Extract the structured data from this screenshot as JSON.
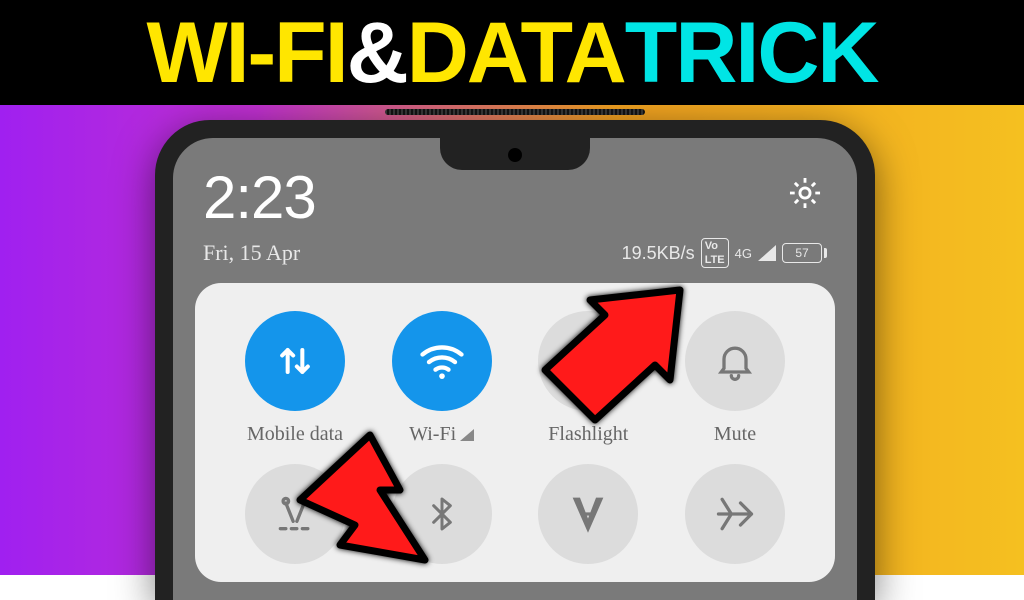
{
  "title": {
    "part1": "WI-FI",
    "part2": " & ",
    "part3": "DATA ",
    "part4": "TRICK"
  },
  "status": {
    "time": "2:23",
    "date": "Fri, 15 Apr",
    "speed": "19.5KB/s",
    "volte": "Vo LTE",
    "signal": "4G",
    "battery": "57"
  },
  "tiles": {
    "row1": [
      {
        "label": "Mobile data",
        "active": true,
        "icon": "data"
      },
      {
        "label": "Wi-Fi",
        "active": true,
        "icon": "wifi",
        "signal": true
      },
      {
        "label": "Flashlight",
        "active": false,
        "icon": "flash"
      },
      {
        "label": "Mute",
        "active": false,
        "icon": "bell"
      }
    ],
    "row2": [
      {
        "icon": "screenshot"
      },
      {
        "icon": "bluetooth"
      },
      {
        "icon": "readmode"
      },
      {
        "icon": "airplane"
      }
    ]
  }
}
